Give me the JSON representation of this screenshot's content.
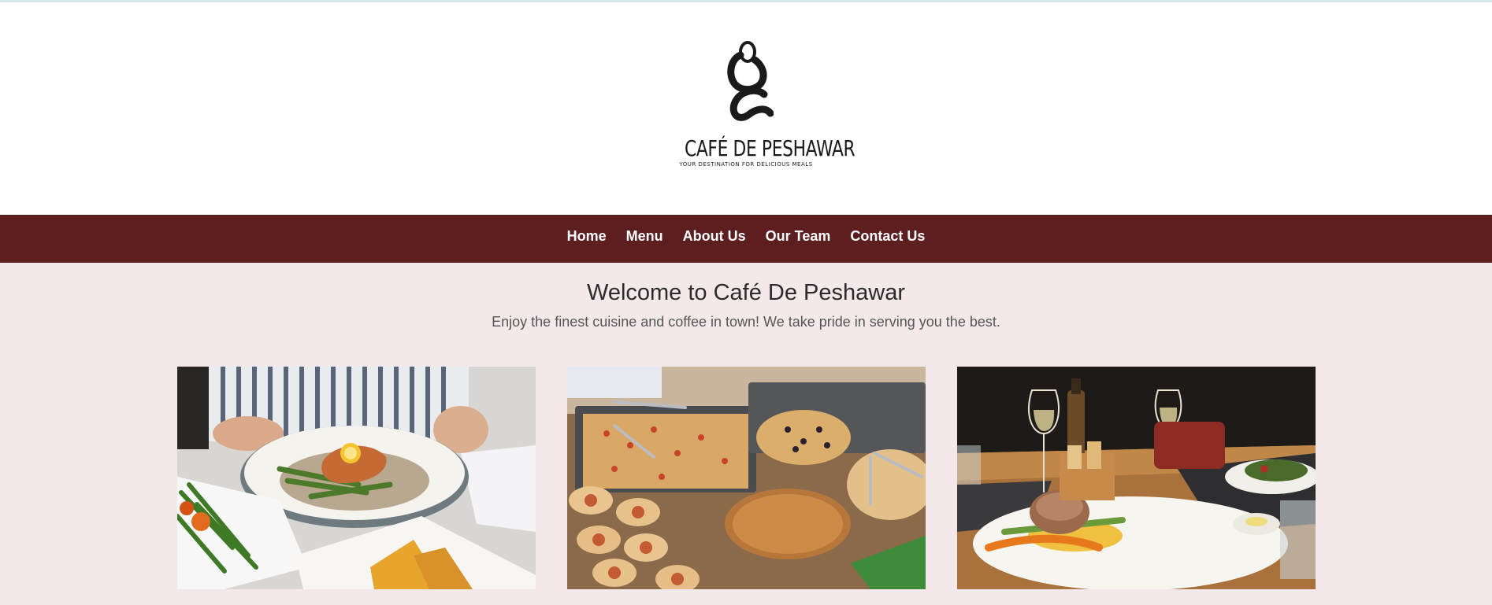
{
  "header": {
    "logo": {
      "name": "CAFÉ DE PESHAWAR",
      "tagline": "YOUR DESTINATION FOR DELICIOUS MEALS",
      "icon": "seated-figure-logo-icon"
    }
  },
  "nav": {
    "items": [
      {
        "label": "Home"
      },
      {
        "label": "Menu"
      },
      {
        "label": "About Us"
      },
      {
        "label": "Our Team"
      },
      {
        "label": "Contact Us"
      }
    ]
  },
  "hero": {
    "title": "Welcome to Café De Peshawar",
    "subtitle": "Enjoy the finest cuisine and coffee in town! We take pride in serving you the best."
  },
  "gallery": {
    "photos": [
      {
        "subject": "salmon-dish-photo"
      },
      {
        "subject": "baked-goods-buffet-photo"
      },
      {
        "subject": "fine-dining-plate-photo"
      }
    ]
  },
  "colors": {
    "nav_background": "#5c1e1f",
    "page_background": "#f3e8ea",
    "header_background": "#ffffff"
  }
}
